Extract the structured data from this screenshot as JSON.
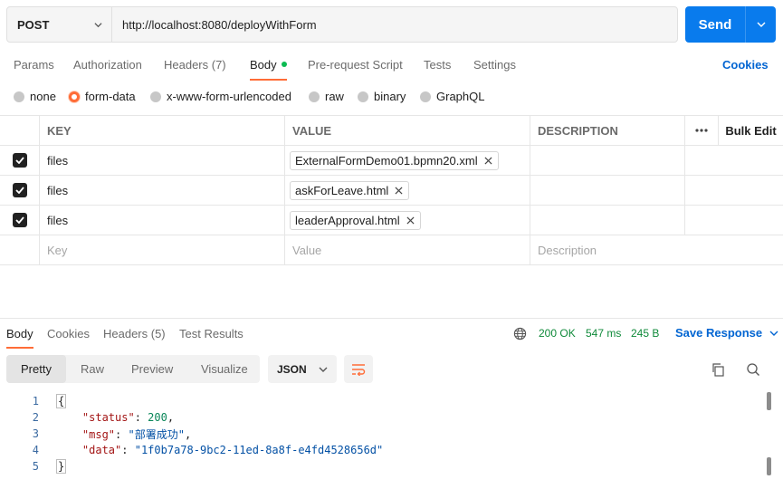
{
  "request": {
    "method": "POST",
    "url": "http://localhost:8080/deployWithForm",
    "send_label": "Send"
  },
  "request_tabs": {
    "params": "Params",
    "authorization": "Authorization",
    "headers": "Headers (7)",
    "body": "Body",
    "pre_request": "Pre-request Script",
    "tests": "Tests",
    "settings": "Settings",
    "cookies": "Cookies"
  },
  "body_types": {
    "none": "none",
    "form_data": "form-data",
    "urlencoded": "x-www-form-urlencoded",
    "raw": "raw",
    "binary": "binary",
    "graphql": "GraphQL",
    "selected": "form-data"
  },
  "form_table": {
    "headers": {
      "key": "KEY",
      "value": "VALUE",
      "description": "DESCRIPTION",
      "bulk_edit": "Bulk Edit"
    },
    "rows": [
      {
        "key": "files",
        "file": "ExternalFormDemo01.bpmn20.xml",
        "checked": true
      },
      {
        "key": "files",
        "file": "askForLeave.html",
        "checked": true
      },
      {
        "key": "files",
        "file": "leaderApproval.html",
        "checked": true
      }
    ],
    "placeholders": {
      "key": "Key",
      "value": "Value",
      "description": "Description"
    }
  },
  "response_tabs": {
    "body": "Body",
    "cookies": "Cookies",
    "headers": "Headers (5)",
    "test_results": "Test Results"
  },
  "response_status": {
    "status": "200 OK",
    "time": "547 ms",
    "size": "245 B",
    "save_response": "Save Response"
  },
  "view_modes": {
    "pretty": "Pretty",
    "raw": "Raw",
    "preview": "Preview",
    "visualize": "Visualize",
    "format": "JSON"
  },
  "response_body": {
    "line_numbers": [
      "1",
      "2",
      "3",
      "4",
      "5"
    ],
    "open_brace": "{",
    "close_brace": "}",
    "status_key": "\"status\"",
    "status_value": "200",
    "msg_key": "\"msg\"",
    "msg_value": "\"部署成功\"",
    "data_key": "\"data\"",
    "data_value": "\"1f0b7a78-9bc2-11ed-8a8f-e4fd4528656d\""
  },
  "colors": {
    "accent": "#ff6c37",
    "send_button": "#097bed",
    "link": "#0265d2",
    "status_ok": "#0f8a3a"
  }
}
